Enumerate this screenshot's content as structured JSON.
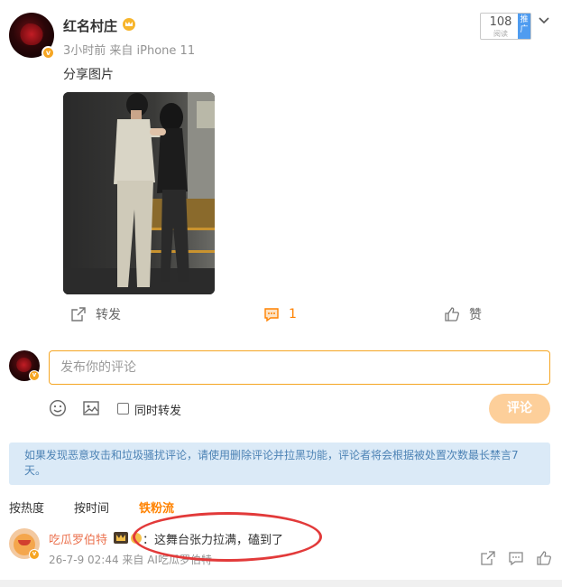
{
  "post": {
    "username": "红名村庄",
    "meta": "3小时前 来自 iPhone 11",
    "text": "分享图片",
    "read_count": "108",
    "read_label": "阅读",
    "promote_label": "推广"
  },
  "actions": {
    "repost_label": "转发",
    "comment_count": "1",
    "like_label": "赞"
  },
  "compose": {
    "placeholder": "发布你的评论",
    "repost_checkbox_label": "同时转发",
    "submit_label": "评论"
  },
  "notice": "如果发现恶意攻击和垃圾骚扰评论，请使用删除评论并拉黑功能，评论者将会根据被处置次数最长禁言7天。",
  "sort_tabs": [
    {
      "label": "按热度",
      "active": false
    },
    {
      "label": "按时间",
      "active": false
    },
    {
      "label": "铁粉流",
      "active": true
    }
  ],
  "comment": {
    "name": "吃瓜罗伯特",
    "text": "：这舞台张力拉满，磕到了",
    "meta": "26-7-9 02:44 来自 AI吃瓜罗伯特"
  },
  "colors": {
    "accent": "#ff8200",
    "input_border": "#f5a623",
    "notice_bg": "#dbeaf7",
    "notice_text": "#4d83b5",
    "highlight_ellipse": "#e23a3a",
    "comment_name": "#eb7350"
  }
}
